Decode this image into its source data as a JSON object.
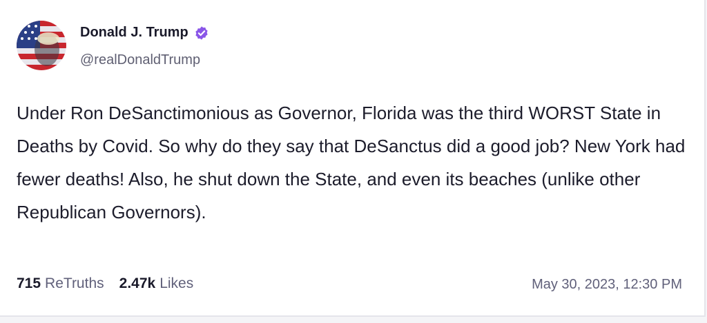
{
  "author": {
    "display_name": "Donald J. Trump",
    "handle": "@realDonaldTrump",
    "verified_icon": "verified-badge-icon",
    "verified_color": "#8a56e8"
  },
  "post": {
    "text": "Under Ron DeSanctimonious as Governor, Florida was the third WORST State in Deaths by Covid. So why do they say that DeSanctus did a good job? New York had fewer deaths! Also, he shut down the State, and even its beaches (unlike other Republican Governors)."
  },
  "stats": {
    "retruths_count": "715",
    "retruths_label": "ReTruths",
    "likes_count": "2.47k",
    "likes_label": "Likes"
  },
  "timestamp": "May 30, 2023, 12:30 PM"
}
